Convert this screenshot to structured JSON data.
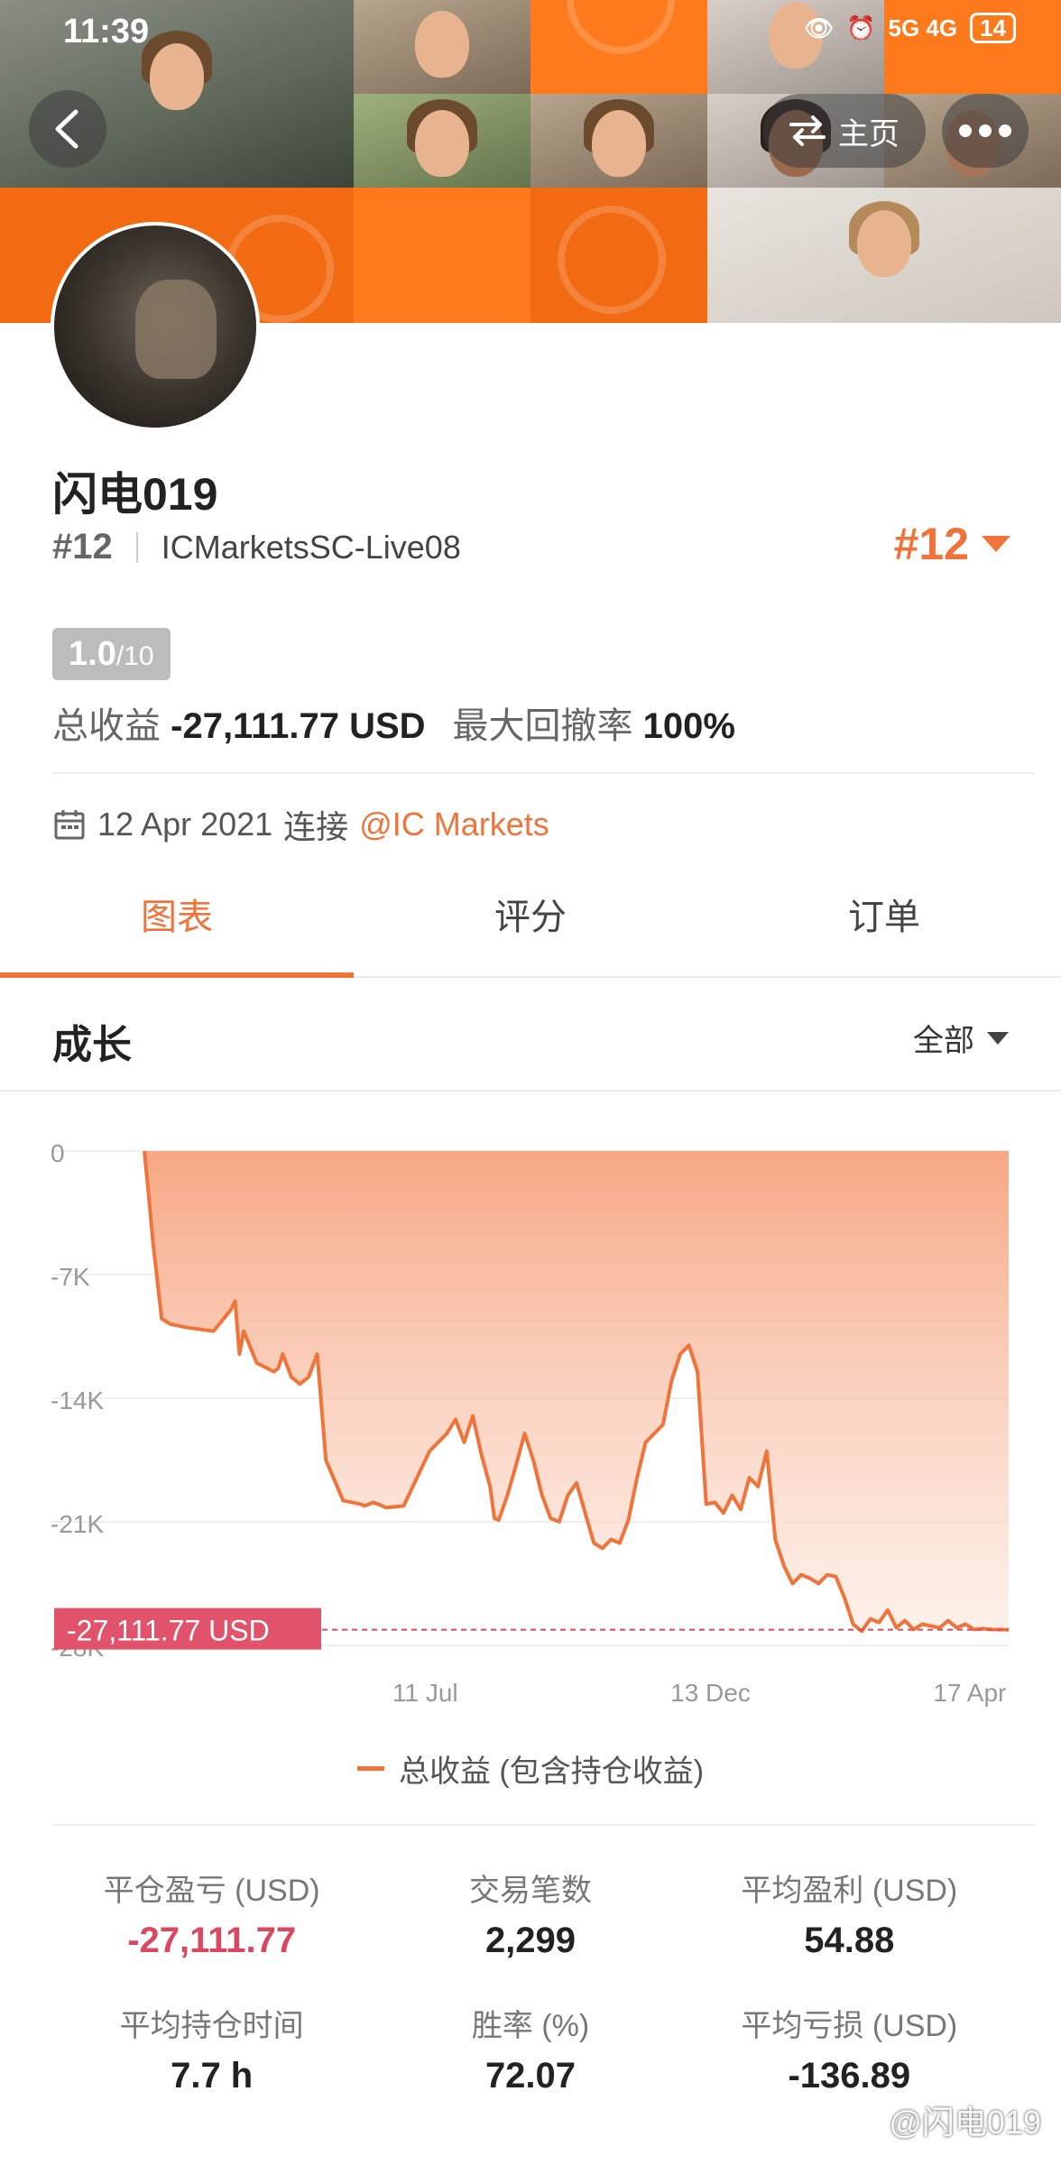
{
  "status_bar": {
    "time": "11:39",
    "signal": "5G 4G",
    "battery": "14"
  },
  "header": {
    "back_icon": "chevron-left-icon",
    "home_label": "主页",
    "swap_icon": "swap-icon",
    "more_icon": "more-dots-icon"
  },
  "profile": {
    "name": "闪电019",
    "rank_hash": "#12",
    "account": "ICMarketsSC-Live08",
    "rank_right": "#12",
    "score_big": "1.0",
    "score_small": "/10",
    "total_profit_label": "总收益",
    "total_profit_value": "-27,111.77 USD",
    "max_drawdown_label": "最大回撤率",
    "max_drawdown_value": "100%",
    "date": "12 Apr 2021",
    "connect_label": "连接",
    "broker": "@IC Markets"
  },
  "tabs": [
    {
      "label": "图表",
      "active": true
    },
    {
      "label": "评分",
      "active": false
    },
    {
      "label": "订单",
      "active": false
    }
  ],
  "section": {
    "title": "成长",
    "range": "全部"
  },
  "chart_data": {
    "type": "area",
    "ylim": [
      -28000,
      0
    ],
    "yticks": [
      "0",
      "-7K",
      "-14K",
      "-21K",
      "-28K"
    ],
    "ytick_values": [
      0,
      -7000,
      -14000,
      -21000,
      -28000
    ],
    "xticks": [
      "11 Jul",
      "13 Dec",
      "17 Apr"
    ],
    "xtick_fractions": [
      0.325,
      0.655,
      0.955
    ],
    "current_value_label": "-27,111.77 USD",
    "current_value": -27111.77,
    "series": [
      {
        "name": "总收益 (包含持仓收益)",
        "color": "#f0743a",
        "x": [
          0,
          0.005,
          0.01,
          0.02,
          0.03,
          0.05,
          0.08,
          0.1,
          0.105,
          0.11,
          0.115,
          0.13,
          0.15,
          0.155,
          0.16,
          0.17,
          0.18,
          0.19,
          0.2,
          0.21,
          0.23,
          0.25,
          0.255,
          0.26,
          0.265,
          0.27,
          0.28,
          0.3,
          0.33,
          0.35,
          0.36,
          0.37,
          0.38,
          0.39,
          0.4,
          0.405,
          0.41,
          0.42,
          0.43,
          0.44,
          0.45,
          0.46,
          0.47,
          0.48,
          0.49,
          0.5,
          0.51,
          0.52,
          0.53,
          0.54,
          0.55,
          0.56,
          0.57,
          0.58,
          0.59,
          0.6,
          0.61,
          0.62,
          0.63,
          0.64,
          0.65,
          0.66,
          0.67,
          0.675,
          0.68,
          0.69,
          0.7,
          0.71,
          0.72,
          0.73,
          0.74,
          0.75,
          0.76,
          0.77,
          0.78,
          0.79,
          0.8,
          0.81,
          0.82,
          0.83,
          0.84,
          0.85,
          0.86,
          0.87,
          0.88,
          0.89,
          0.9,
          0.91,
          0.92,
          0.93,
          0.94,
          0.95,
          0.96,
          0.97,
          0.98,
          1
        ],
        "values": [
          0,
          -2500,
          -5200,
          -9500,
          -9800,
          -10000,
          -10200,
          -9000,
          -8500,
          -11500,
          -10200,
          -12000,
          -12500,
          -12300,
          -11500,
          -12800,
          -13200,
          -12800,
          -11500,
          -17500,
          -19800,
          -20000,
          -20100,
          -20000,
          -19900,
          -20000,
          -20200,
          -20100,
          -17000,
          -16000,
          -15200,
          -16500,
          -15000,
          -17200,
          -19000,
          -20800,
          -20900,
          -19500,
          -17800,
          -16000,
          -17500,
          -19500,
          -20800,
          -21000,
          -19500,
          -18800,
          -20500,
          -22200,
          -22500,
          -22000,
          -22200,
          -20900,
          -18500,
          -16500,
          -16000,
          -15500,
          -13000,
          -11500,
          -11000,
          -12500,
          -20000,
          -19900,
          -20500,
          -20000,
          -19500,
          -20300,
          -18500,
          -19000,
          -17000,
          -22000,
          -23500,
          -24500,
          -24000,
          -24200,
          -24500,
          -24000,
          -24100,
          -25300,
          -26800,
          -27200,
          -26500,
          -26700,
          -26000,
          -27000,
          -26600,
          -27100,
          -26800,
          -26900,
          -27000,
          -26600,
          -27000,
          -26800,
          -27100,
          -27050,
          -27100,
          -27111.77
        ]
      }
    ]
  },
  "legend": {
    "label": "总收益 (包含持仓收益)"
  },
  "stats": [
    {
      "label": "平仓盈亏 (USD)",
      "value": "-27,111.77",
      "negative": true
    },
    {
      "label": "交易笔数",
      "value": "2,299",
      "negative": false
    },
    {
      "label": "平均盈利 (USD)",
      "value": "54.88",
      "negative": false
    },
    {
      "label": "平均持仓时间",
      "value": "7.7 h",
      "negative": false
    },
    {
      "label": "胜率 (%)",
      "value": "72.07",
      "negative": false
    },
    {
      "label": "平均亏损 (USD)",
      "value": "-136.89",
      "negative": false
    }
  ],
  "watermark": "@闪电019",
  "colors": {
    "accent": "#f0743a",
    "banner": "#ff7a1c",
    "negative": "#d9485f"
  }
}
